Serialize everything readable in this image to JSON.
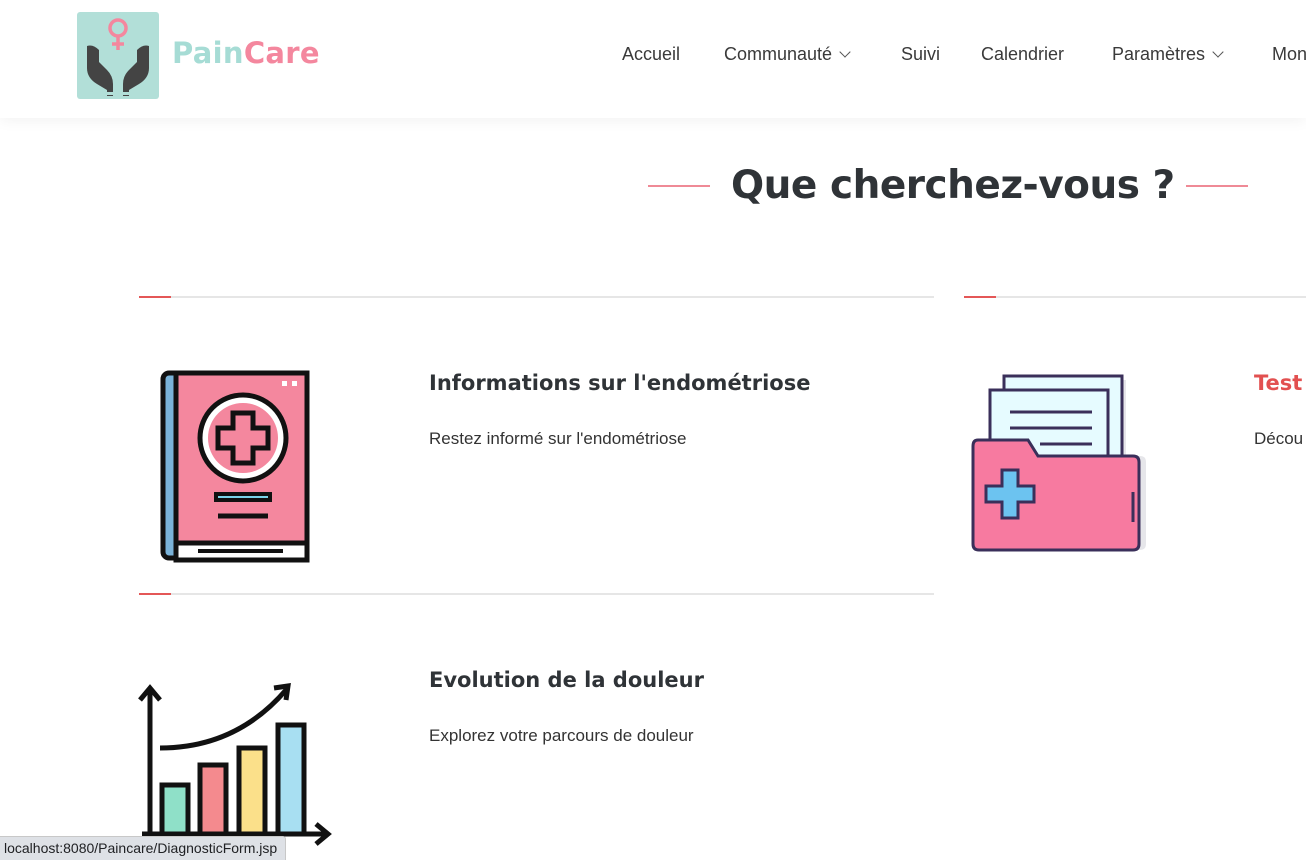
{
  "brand": {
    "part1": "Pain",
    "part2": "Care"
  },
  "nav": {
    "items": [
      {
        "label": "Accueil"
      },
      {
        "label": "Communauté"
      },
      {
        "label": "Suivi"
      },
      {
        "label": "Calendrier"
      },
      {
        "label": "Paramètres"
      },
      {
        "label": "Mon"
      }
    ]
  },
  "section": {
    "title": "Que cherchez-vous ?"
  },
  "cards": [
    {
      "title": "Informations sur l'endométriose",
      "description": "Restez informé sur l'endométriose"
    },
    {
      "title": "Test",
      "description": "Décou"
    },
    {
      "title": "Evolution de la douleur",
      "description": "Explorez votre parcours de douleur"
    }
  ],
  "status": {
    "url": "localhost:8080/Paincare/DiagnosticForm.jsp"
  },
  "colors": {
    "accent_red": "#e45757",
    "brand_teal": "#a6dcd5",
    "brand_pink": "#f4879e"
  }
}
